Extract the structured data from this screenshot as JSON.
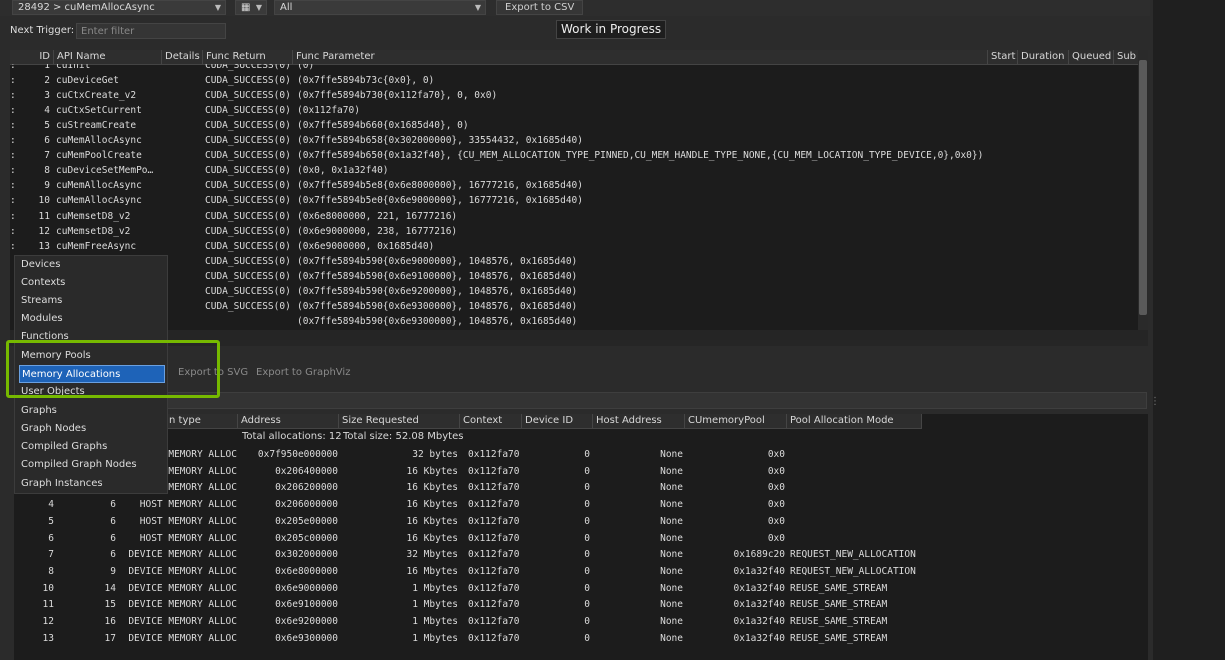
{
  "toolbar": {
    "api_select": "28492 > cuMemAllocAsync",
    "filter_select": "All",
    "export_csv": "Export to CSV"
  },
  "trigger": {
    "label": "Next Trigger:",
    "placeholder": "Enter filter"
  },
  "status": "Work in Progress",
  "api_table": {
    "headers": [
      "ID",
      "API Name",
      "Details",
      "Func Return",
      "Func Parameter",
      "Start",
      "Duration",
      "Queued",
      "Sub"
    ],
    "rows": [
      {
        "id": "1",
        "name": "cuInit",
        "ret": "CUDA_SUCCESS(0)",
        "param": "(0)"
      },
      {
        "id": "2",
        "name": "cuDeviceGet",
        "ret": "CUDA_SUCCESS(0)",
        "param": "(0x7ffe5894b73c{0x0}, 0)"
      },
      {
        "id": "3",
        "name": "cuCtxCreate_v2",
        "ret": "CUDA_SUCCESS(0)",
        "param": "(0x7ffe5894b730{0x112fa70}, 0, 0x0)"
      },
      {
        "id": "4",
        "name": "cuCtxSetCurrent",
        "ret": "CUDA_SUCCESS(0)",
        "param": "(0x112fa70)"
      },
      {
        "id": "5",
        "name": "cuStreamCreate",
        "ret": "CUDA_SUCCESS(0)",
        "param": "(0x7ffe5894b660{0x1685d40}, 0)"
      },
      {
        "id": "6",
        "name": "cuMemAllocAsync",
        "ret": "CUDA_SUCCESS(0)",
        "param": "(0x7ffe5894b658{0x302000000}, 33554432, 0x1685d40)"
      },
      {
        "id": "7",
        "name": "cuMemPoolCreate",
        "ret": "CUDA_SUCCESS(0)",
        "param": "(0x7ffe5894b650{0x1a32f40}, {CU_MEM_ALLOCATION_TYPE_PINNED,CU_MEM_HANDLE_TYPE_NONE,{CU_MEM_LOCATION_TYPE_DEVICE,0},0x0})"
      },
      {
        "id": "8",
        "name": "cuDeviceSetMemPo…",
        "ret": "CUDA_SUCCESS(0)",
        "param": "(0x0, 0x1a32f40)"
      },
      {
        "id": "9",
        "name": "cuMemAllocAsync",
        "ret": "CUDA_SUCCESS(0)",
        "param": "(0x7ffe5894b5e8{0x6e8000000}, 16777216, 0x1685d40)"
      },
      {
        "id": "10",
        "name": "cuMemAllocAsync",
        "ret": "CUDA_SUCCESS(0)",
        "param": "(0x7ffe5894b5e0{0x6e9000000}, 16777216, 0x1685d40)"
      },
      {
        "id": "11",
        "name": "cuMemsetD8_v2",
        "ret": "CUDA_SUCCESS(0)",
        "param": "(0x6e8000000, 221, 16777216)"
      },
      {
        "id": "12",
        "name": "cuMemsetD8_v2",
        "ret": "CUDA_SUCCESS(0)",
        "param": "(0x6e9000000, 238, 16777216)"
      },
      {
        "id": "13",
        "name": "cuMemFreeAsync",
        "ret": "CUDA_SUCCESS(0)",
        "param": "(0x6e9000000, 0x1685d40)"
      },
      {
        "id": "",
        "name": "",
        "ret": "CUDA_SUCCESS(0)",
        "param": "(0x7ffe5894b590{0x6e9000000}, 1048576, 0x1685d40)"
      },
      {
        "id": "",
        "name": "",
        "ret": "CUDA_SUCCESS(0)",
        "param": "(0x7ffe5894b590{0x6e9100000}, 1048576, 0x1685d40)"
      },
      {
        "id": "",
        "name": "",
        "ret": "CUDA_SUCCESS(0)",
        "param": "(0x7ffe5894b590{0x6e9200000}, 1048576, 0x1685d40)"
      },
      {
        "id": "",
        "name": "",
        "ret": "CUDA_SUCCESS(0)",
        "param": "(0x7ffe5894b590{0x6e9300000}, 1048576, 0x1685d40)"
      },
      {
        "id": "",
        "name": "",
        "ret": "",
        "param": "(0x7ffe5894b590{0x6e9300000}, 1048576, 0x1685d40)"
      }
    ]
  },
  "context_menu": {
    "items": [
      "Devices",
      "Contexts",
      "Streams",
      "Modules",
      "Functions",
      "Memory Pools",
      "Memory Allocations",
      "User Objects",
      "Graphs",
      "Graph Nodes",
      "Compiled Graphs",
      "Compiled Graph Nodes",
      "Graph Instances"
    ],
    "selected": "Memory Allocations"
  },
  "export": {
    "svg": "Export to SVG",
    "graphviz": "Export to GraphViz"
  },
  "alloc_table": {
    "headers": [
      "n type",
      "Address",
      "Size Requested",
      "Context",
      "Device ID",
      "Host Address",
      "CUmemoryPool",
      "Pool Allocation Mode"
    ],
    "summary": {
      "total_allocations": "Total allocations: 12",
      "total_size": "Total size: 52.08 Mbytes"
    },
    "rows": [
      {
        "a": "",
        "b": "",
        "type": "MEMORY ALLOC",
        "addr": "0x7f950e000000",
        "size": "32 bytes",
        "ctx": "0x112fa70",
        "dev": "0",
        "host": "None",
        "pool": "0x0",
        "mode": ""
      },
      {
        "a": "",
        "b": "",
        "type": "MEMORY ALLOC",
        "addr": "0x206400000",
        "size": "16 Kbytes",
        "ctx": "0x112fa70",
        "dev": "0",
        "host": "None",
        "pool": "0x0",
        "mode": ""
      },
      {
        "a": "",
        "b": "",
        "type": "MEMORY ALLOC",
        "addr": "0x206200000",
        "size": "16 Kbytes",
        "ctx": "0x112fa70",
        "dev": "0",
        "host": "None",
        "pool": "0x0",
        "mode": ""
      },
      {
        "a": "4",
        "b": "6",
        "type": "HOST MEMORY ALLOC",
        "addr": "0x206000000",
        "size": "16 Kbytes",
        "ctx": "0x112fa70",
        "dev": "0",
        "host": "None",
        "pool": "0x0",
        "mode": ""
      },
      {
        "a": "5",
        "b": "6",
        "type": "HOST MEMORY ALLOC",
        "addr": "0x205e00000",
        "size": "16 Kbytes",
        "ctx": "0x112fa70",
        "dev": "0",
        "host": "None",
        "pool": "0x0",
        "mode": ""
      },
      {
        "a": "6",
        "b": "6",
        "type": "HOST MEMORY ALLOC",
        "addr": "0x205c00000",
        "size": "16 Kbytes",
        "ctx": "0x112fa70",
        "dev": "0",
        "host": "None",
        "pool": "0x0",
        "mode": ""
      },
      {
        "a": "7",
        "b": "6",
        "type": "DEVICE MEMORY ALLOC",
        "addr": "0x302000000",
        "size": "32 Mbytes",
        "ctx": "0x112fa70",
        "dev": "0",
        "host": "None",
        "pool": "0x1689c20",
        "mode": "REQUEST_NEW_ALLOCATION"
      },
      {
        "a": "8",
        "b": "9",
        "type": "DEVICE MEMORY ALLOC",
        "addr": "0x6e8000000",
        "size": "16 Mbytes",
        "ctx": "0x112fa70",
        "dev": "0",
        "host": "None",
        "pool": "0x1a32f40",
        "mode": "REQUEST_NEW_ALLOCATION"
      },
      {
        "a": "10",
        "b": "14",
        "type": "DEVICE MEMORY ALLOC",
        "addr": "0x6e9000000",
        "size": "1 Mbytes",
        "ctx": "0x112fa70",
        "dev": "0",
        "host": "None",
        "pool": "0x1a32f40",
        "mode": "REUSE_SAME_STREAM"
      },
      {
        "a": "11",
        "b": "15",
        "type": "DEVICE MEMORY ALLOC",
        "addr": "0x6e9100000",
        "size": "1 Mbytes",
        "ctx": "0x112fa70",
        "dev": "0",
        "host": "None",
        "pool": "0x1a32f40",
        "mode": "REUSE_SAME_STREAM"
      },
      {
        "a": "12",
        "b": "16",
        "type": "DEVICE MEMORY ALLOC",
        "addr": "0x6e9200000",
        "size": "1 Mbytes",
        "ctx": "0x112fa70",
        "dev": "0",
        "host": "None",
        "pool": "0x1a32f40",
        "mode": "REUSE_SAME_STREAM"
      },
      {
        "a": "13",
        "b": "17",
        "type": "DEVICE MEMORY ALLOC",
        "addr": "0x6e9300000",
        "size": "1 Mbytes",
        "ctx": "0x112fa70",
        "dev": "0",
        "host": "None",
        "pool": "0x1a32f40",
        "mode": "REUSE_SAME_STREAM"
      }
    ]
  }
}
